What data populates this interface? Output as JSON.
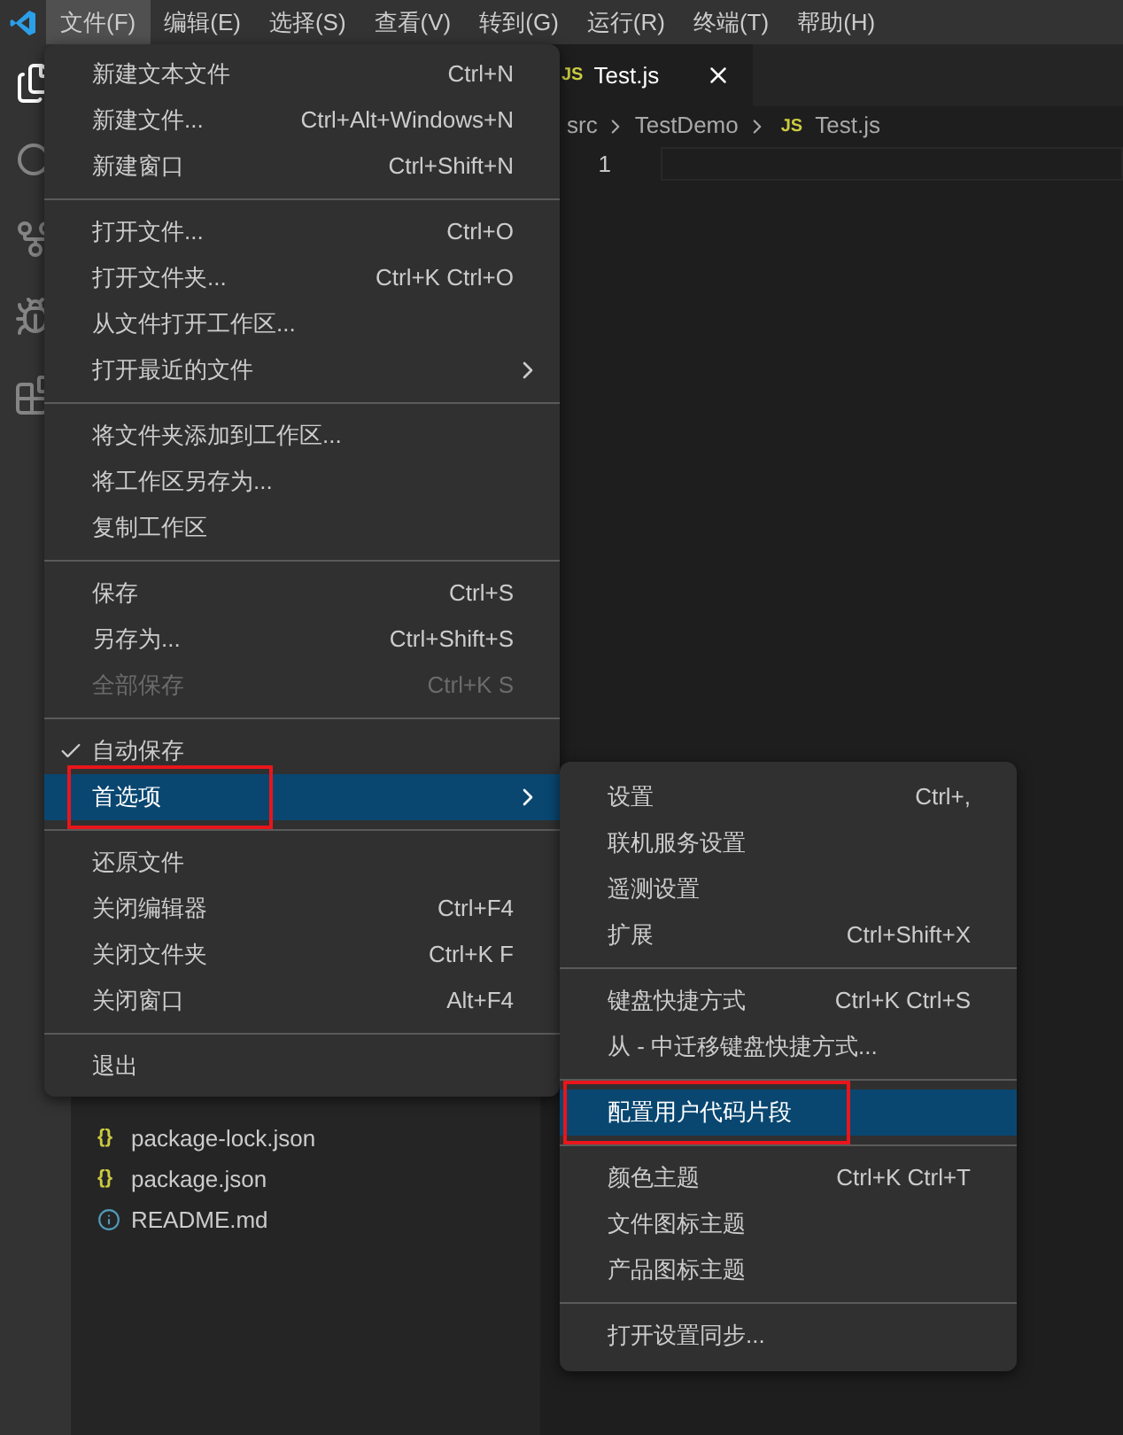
{
  "menubar": [
    {
      "label": "文件(F)",
      "selected": true
    },
    {
      "label": "编辑(E)",
      "selected": false
    },
    {
      "label": "选择(S)",
      "selected": false
    },
    {
      "label": "查看(V)",
      "selected": false
    },
    {
      "label": "转到(G)",
      "selected": false
    },
    {
      "label": "运行(R)",
      "selected": false
    },
    {
      "label": "终端(T)",
      "selected": false
    },
    {
      "label": "帮助(H)",
      "selected": false
    }
  ],
  "editor": {
    "tab": {
      "badge": "JS",
      "label": "Test.js"
    },
    "breadcrumb": [
      {
        "label": "src"
      },
      {
        "label": "TestDemo"
      },
      {
        "label": "Test.js",
        "badge": "JS"
      }
    ],
    "line_numbers": [
      "1"
    ]
  },
  "explorer": {
    "files": [
      {
        "name": "package-lock.json",
        "kind": "json",
        "icon": "{}"
      },
      {
        "name": "package.json",
        "kind": "json",
        "icon": "{}"
      },
      {
        "name": "README.md",
        "kind": "info"
      }
    ]
  },
  "file_menu": {
    "items": [
      {
        "kind": "item",
        "label": "新建文本文件",
        "shortcut": "Ctrl+N"
      },
      {
        "kind": "item",
        "label": "新建文件...",
        "shortcut": "Ctrl+Alt+Windows+N"
      },
      {
        "kind": "item",
        "label": "新建窗口",
        "shortcut": "Ctrl+Shift+N"
      },
      {
        "kind": "separator"
      },
      {
        "kind": "item",
        "label": "打开文件...",
        "shortcut": "Ctrl+O"
      },
      {
        "kind": "item",
        "label": "打开文件夹...",
        "shortcut": "Ctrl+K Ctrl+O"
      },
      {
        "kind": "item",
        "label": "从文件打开工作区..."
      },
      {
        "kind": "item",
        "label": "打开最近的文件",
        "submenu": true
      },
      {
        "kind": "separator"
      },
      {
        "kind": "item",
        "label": "将文件夹添加到工作区..."
      },
      {
        "kind": "item",
        "label": "将工作区另存为..."
      },
      {
        "kind": "item",
        "label": "复制工作区"
      },
      {
        "kind": "separator"
      },
      {
        "kind": "item",
        "label": "保存",
        "shortcut": "Ctrl+S"
      },
      {
        "kind": "item",
        "label": "另存为...",
        "shortcut": "Ctrl+Shift+S"
      },
      {
        "kind": "item",
        "label": "全部保存",
        "shortcut": "Ctrl+K S",
        "disabled": true
      },
      {
        "kind": "separator"
      },
      {
        "kind": "item",
        "label": "自动保存",
        "checked": true
      },
      {
        "kind": "item",
        "label": "首选项",
        "submenu": true,
        "selected": true,
        "highlighted": true
      },
      {
        "kind": "separator"
      },
      {
        "kind": "item",
        "label": "还原文件"
      },
      {
        "kind": "item",
        "label": "关闭编辑器",
        "shortcut": "Ctrl+F4"
      },
      {
        "kind": "item",
        "label": "关闭文件夹",
        "shortcut": "Ctrl+K F"
      },
      {
        "kind": "item",
        "label": "关闭窗口",
        "shortcut": "Alt+F4"
      },
      {
        "kind": "separator"
      },
      {
        "kind": "item",
        "label": "退出"
      }
    ]
  },
  "preferences_menu": {
    "items": [
      {
        "kind": "item",
        "label": "设置",
        "shortcut": "Ctrl+,"
      },
      {
        "kind": "item",
        "label": "联机服务设置"
      },
      {
        "kind": "item",
        "label": "遥测设置"
      },
      {
        "kind": "item",
        "label": "扩展",
        "shortcut": "Ctrl+Shift+X"
      },
      {
        "kind": "separator"
      },
      {
        "kind": "item",
        "label": "键盘快捷方式",
        "shortcut": "Ctrl+K Ctrl+S"
      },
      {
        "kind": "item",
        "label": "从 - 中迁移键盘快捷方式..."
      },
      {
        "kind": "separator"
      },
      {
        "kind": "item",
        "label": "配置用户代码片段",
        "selected": true,
        "highlighted": true
      },
      {
        "kind": "separator"
      },
      {
        "kind": "item",
        "label": "颜色主题",
        "shortcut": "Ctrl+K Ctrl+T"
      },
      {
        "kind": "item",
        "label": "文件图标主题"
      },
      {
        "kind": "item",
        "label": "产品图标主题"
      },
      {
        "kind": "separator"
      },
      {
        "kind": "item",
        "label": "打开设置同步..."
      }
    ]
  }
}
